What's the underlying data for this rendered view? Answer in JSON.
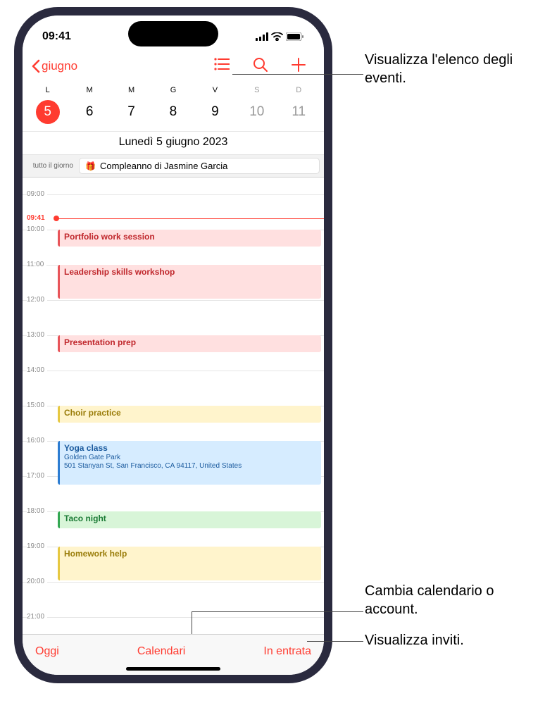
{
  "status": {
    "time": "09:41"
  },
  "nav": {
    "back_label": "giugno"
  },
  "week": {
    "day_letters": [
      "L",
      "M",
      "M",
      "G",
      "V",
      "S",
      "D"
    ],
    "day_numbers": [
      "5",
      "6",
      "7",
      "8",
      "9",
      "10",
      "11"
    ],
    "selected_index": 0
  },
  "date_title": "Lunedì  5 giugno 2023",
  "allday": {
    "label": "tutto il giorno",
    "event": "Compleanno di Jasmine Garcia"
  },
  "now": {
    "label": "09:41"
  },
  "hours": [
    "09:00",
    "10:00",
    "11:00",
    "12:00",
    "13:00",
    "14:00",
    "15:00",
    "16:00",
    "17:00",
    "18:00",
    "19:00",
    "20:00",
    "21:00"
  ],
  "events": [
    {
      "title": "Portfolio work session"
    },
    {
      "title": "Leadership skills workshop"
    },
    {
      "title": "Presentation prep"
    },
    {
      "title": "Choir practice"
    },
    {
      "title": "Yoga class",
      "loc1": "Golden Gate Park",
      "loc2": "501 Stanyan St, San Francisco, CA 94117, United States"
    },
    {
      "title": "Taco night"
    },
    {
      "title": "Homework help"
    }
  ],
  "bottom": {
    "today": "Oggi",
    "calendars": "Calendari",
    "inbox": "In entrata"
  },
  "callouts": {
    "list": "Visualizza l'elenco degli eventi.",
    "change": "Cambia calendario o account.",
    "invites": "Visualizza inviti."
  }
}
